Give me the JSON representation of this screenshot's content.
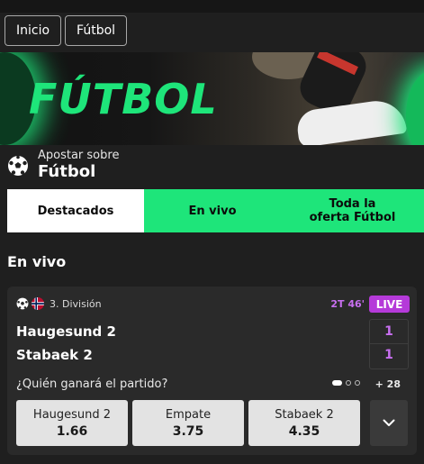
{
  "breadcrumbs": [
    "Inicio",
    "Fútbol"
  ],
  "banner": {
    "title": "FÚTBOL"
  },
  "bet_header": {
    "subtitle": "Apostar sobre",
    "title": "Fútbol",
    "icon": "soccer-ball-icon"
  },
  "tabs": [
    {
      "label": "Destacados",
      "active": true
    },
    {
      "label": "En vivo",
      "active": false
    },
    {
      "label": "Toda la oferta Fútbol",
      "active": false
    }
  ],
  "section_title": "En vivo",
  "match": {
    "league": "3. División",
    "league_icons": [
      "soccer-ball-icon",
      "norway-flag-icon"
    ],
    "time": "2T 46'",
    "live_badge": "LIVE",
    "teams": [
      {
        "name": "Haugesund 2",
        "score": "1"
      },
      {
        "name": "Stabaek 2",
        "score": "1"
      }
    ],
    "question": "¿Quién ganará el partido?",
    "more_markets": "+ 28",
    "odds": [
      {
        "name": "Haugesund 2",
        "value": "1.66"
      },
      {
        "name": "Empate",
        "value": "3.75"
      },
      {
        "name": "Stabaek 2",
        "value": "4.35"
      }
    ]
  },
  "colors": {
    "accent": "#1ee57a",
    "live": "#b53ad9",
    "background": "#1f1f1f"
  }
}
